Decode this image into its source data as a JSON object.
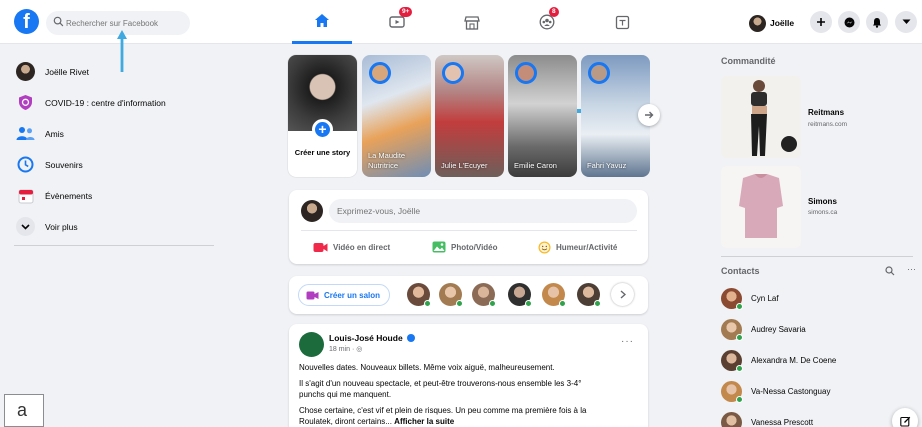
{
  "header": {
    "search_placeholder": "Rechercher sur Facebook",
    "nav": [
      {
        "name": "home",
        "badge": ""
      },
      {
        "name": "watch",
        "badge": "9+"
      },
      {
        "name": "marketplace",
        "badge": ""
      },
      {
        "name": "groups",
        "badge": "8"
      },
      {
        "name": "gaming",
        "badge": ""
      }
    ],
    "profile_name": "Joëlle"
  },
  "sidebar": {
    "items": [
      {
        "label": "Joëlle Rivet",
        "icon": "profile-avatar"
      },
      {
        "label": "COVID-19 : centre d'information",
        "icon": "covid-shield-icon",
        "color": "#b13ec0"
      },
      {
        "label": "Amis",
        "icon": "friends-icon",
        "color": "#1877f2"
      },
      {
        "label": "Souvenirs",
        "icon": "memories-clock-icon",
        "color": "#1877f2"
      },
      {
        "label": "Évènements",
        "icon": "calendar-icon",
        "color": "#e41e3f"
      },
      {
        "label": "Voir plus",
        "icon": "chevron-down-icon"
      }
    ]
  },
  "stories": {
    "create_label": "Créer une story",
    "items": [
      {
        "name": "La Maudite Nutritrice",
        "color": "#8aa6c8"
      },
      {
        "name": "Julie L'Ecuyer",
        "color": "#b07a7a"
      },
      {
        "name": "Emilie Caron",
        "color": "#9a9a9a"
      },
      {
        "name": "Fahri Yavuz",
        "color": "#8fa4b8"
      }
    ]
  },
  "composer": {
    "placeholder": "Exprimez-vous, Joëlle",
    "actions": [
      {
        "label": "Vidéo en direct",
        "color": "#f02849"
      },
      {
        "label": "Photo/Vidéo",
        "color": "#45bd62"
      },
      {
        "label": "Humeur/Activité",
        "color": "#f7b928"
      }
    ]
  },
  "rooms": {
    "create_label": "Créer un salon"
  },
  "post": {
    "author": "Louis-José Houde",
    "meta": "18 min · ◎",
    "lines": [
      "Nouvelles dates. Nouveaux billets. Même voix aiguë, malheureusement.",
      "Il s'agit d'un nouveau spectacle, et peut-être trouverons-nous ensemble les 3-4°",
      "punchs qui me manquent.",
      "Chose certaine, c'est vif et plein de risques. Un peu comme ma première fois à la",
      "Roulatek, diront certains..."
    ],
    "see_more": "Afficher la suite"
  },
  "sponsored": {
    "title": "Commandité",
    "ads": [
      {
        "name": "Reitmans",
        "url": "reitmans.com"
      },
      {
        "name": "Simons",
        "url": "simons.ca"
      }
    ]
  },
  "contacts": {
    "title": "Contacts",
    "items": [
      {
        "name": "Cyn Laf"
      },
      {
        "name": "Audrey Savaria"
      },
      {
        "name": "Alexandra M. De Coene"
      },
      {
        "name": "Va-Nessa Castonguay"
      },
      {
        "name": "Vanessa Prescott"
      }
    ]
  },
  "figure_label": "a",
  "colors": {
    "brand": "#1877f2",
    "annotation_arrow": "#3fa9e0",
    "badge": "#e41e3f"
  }
}
